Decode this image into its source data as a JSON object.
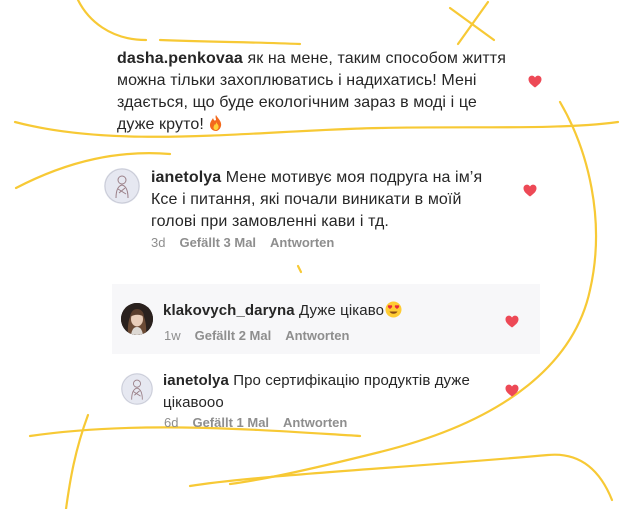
{
  "comments": [
    {
      "username": "dasha.penkovaa",
      "line1": " як на мене, таким способом життя",
      "line2": "можна тільки захоплюватись і надихатись! Мені",
      "line3": "здається, що буде екологічним зараз в моді і це",
      "line4": "дуже круто! ",
      "emoji": "fire"
    },
    {
      "username": "ianetolya",
      "line1": " Мене мотивує моя подруга на ім’я",
      "line2": "Ксе і питання, які почали виникати в моїй",
      "line3": "голові при замовленні кави і тд.",
      "time": "3d",
      "likes": "Gefällt 3 Mal",
      "reply": "Antworten"
    },
    {
      "username": "klakovych_daryna",
      "line1": " Дуже цікаво",
      "emoji": "heart-eyes",
      "time": "1w",
      "likes": "Gefällt 2 Mal",
      "reply": "Antworten"
    },
    {
      "username": "ianetolya",
      "line1": " Про сертифікацію продуктів дуже",
      "line2": "цікавооо",
      "time": "6d",
      "likes": "Gefällt 1 Mal",
      "reply": "Antworten"
    }
  ],
  "colors": {
    "decoration": "#f7c935",
    "heart": "#ed4956",
    "meta": "#8e8e8e",
    "reply_background": "#f7f7f9"
  },
  "icons": [
    "heart-icon",
    "fire-emoji",
    "heart-eyes-emoji",
    "sketch-avatar",
    "photo-avatar"
  ]
}
